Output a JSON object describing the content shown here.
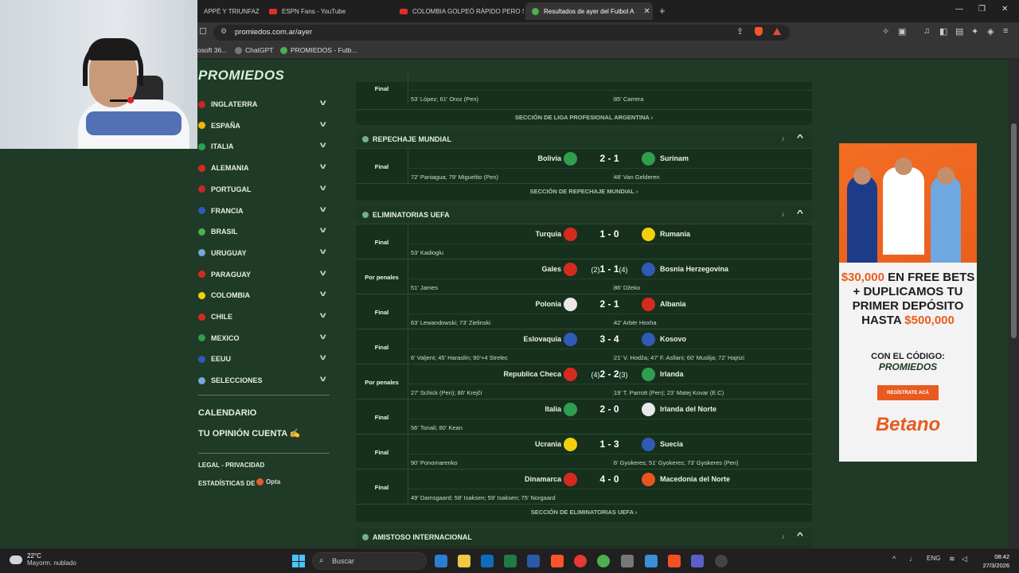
{
  "browser": {
    "tabs": [
      {
        "label": "APPÉ Y TRIUNFAZO :",
        "icon": "yt"
      },
      {
        "label": "ESPN Fans - YouTube",
        "icon": "yt"
      },
      {
        "label": "COLOMBIA GOLPEÓ RÁPIDO PERO S",
        "icon": "yt"
      },
      {
        "label": "Resultados de ayer del Futbol A",
        "icon": "fav",
        "active": true
      }
    ],
    "url": "promiedos.com.ar/ayer",
    "bookmarks": [
      "osoft 36...",
      "ChatGPT",
      "PROMIEDOS - Futb..."
    ]
  },
  "sidebar": {
    "logo": "PROMIEDOS",
    "items": [
      {
        "label": "INGLATERRA",
        "color": "#c62828"
      },
      {
        "label": "ESPAÑA",
        "color": "#f2b705"
      },
      {
        "label": "ITALIA",
        "color": "#2e9e4f"
      },
      {
        "label": "ALEMANIA",
        "color": "#d52b1e"
      },
      {
        "label": "PORTUGAL",
        "color": "#c62828"
      },
      {
        "label": "FRANCIA",
        "color": "#2f5bb7"
      },
      {
        "label": "BRASIL",
        "color": "#4caf50"
      },
      {
        "label": "URUGUAY",
        "color": "#7aa6d8"
      },
      {
        "label": "PARAGUAY",
        "color": "#d52b1e"
      },
      {
        "label": "COLOMBIA",
        "color": "#f2d10a"
      },
      {
        "label": "CHILE",
        "color": "#d52b1e"
      },
      {
        "label": "MEXICO",
        "color": "#2e9e4f"
      },
      {
        "label": "EEUU",
        "color": "#2f5bb7"
      },
      {
        "label": "SELECCIONES",
        "color": "#7aa6d8"
      }
    ],
    "calendario": "CALENDARIO",
    "opinion": "TU OPINIÓN CUENTA ✍",
    "legal": "LEGAL",
    "privacidad": "PRIVACIDAD",
    "estadisticas": "ESTADÍSTICAS DE",
    "opta": "Opta"
  },
  "top_partial": {
    "home_goals": "53' López; 61' Oroz (Pen)",
    "away_goals": "85' Carrera",
    "status": "Final",
    "footer": "SECCIÓN DE LIGA PROFESIONAL ARGENTINA ›"
  },
  "repechaje": {
    "title": "REPECHAJE MUNDIAL",
    "matches": [
      {
        "status": "Final",
        "home": "Bolivia",
        "away": "Surinam",
        "score": "2 - 1",
        "home_goals": "72' Paniagua; 79' Miguelito (Pen)",
        "away_goals": "48' Van Gelderen",
        "hc": "#2e9e4f",
        "ac": "#2e9e4f"
      }
    ],
    "footer": "SECCIÓN DE REPECHAJE MUNDIAL ›"
  },
  "uefa": {
    "title": "ELIMINATORIAS UEFA",
    "matches": [
      {
        "status": "Final",
        "home": "Turquia",
        "away": "Rumania",
        "score": "1 - 0",
        "home_goals": "53' Kadioglu",
        "away_goals": "",
        "hc": "#d52b1e",
        "ac": "#f2d10a"
      },
      {
        "status": "Por penales",
        "home": "Gales",
        "away": "Bosnia Herzegovina",
        "score": "1 - 1",
        "hpen": "(2)",
        "apen": "(4)",
        "home_goals": "51' James",
        "away_goals": "86' Džeko",
        "hc": "#d52b1e",
        "ac": "#2f5bb7"
      },
      {
        "status": "Final",
        "home": "Polonia",
        "away": "Albania",
        "score": "2 - 1",
        "home_goals": "63' Lewandowski; 73' Zielinski",
        "away_goals": "42' Arbër Hoxha",
        "hc": "#e8e8e8",
        "ac": "#d52b1e"
      },
      {
        "status": "Final",
        "home": "Eslovaquia",
        "away": "Kosovo",
        "score": "3 - 4",
        "home_goals": "6' Valjent; 45' Haraslín; 90'+4 Strelec",
        "away_goals": "21' V. Hodža; 47' F. Asllani; 60' Muslija; 72' Hajrizi",
        "hc": "#2f5bb7",
        "ac": "#2f5bb7"
      },
      {
        "status": "Por penales",
        "home": "Republica Checa",
        "away": "Irlanda",
        "score": "2 - 2",
        "hpen": "(4)",
        "apen": "(3)",
        "home_goals": "27' Schick (Pen); 86' Krejčí",
        "away_goals": "19' T. Parrott (Pen); 23' Matej Kovar (E.C)",
        "hc": "#d52b1e",
        "ac": "#2e9e4f"
      },
      {
        "status": "Final",
        "home": "Italia",
        "away": "Irlanda del Norte",
        "score": "2 - 0",
        "home_goals": "56' Tonali; 80' Kean",
        "away_goals": "",
        "hc": "#2e9e4f",
        "ac": "#e8e8e8"
      },
      {
        "status": "Final",
        "home": "Ucrania",
        "away": "Suecia",
        "score": "1 - 3",
        "home_goals": "90' Ponomarenko",
        "away_goals": "6' Gyokeres; 51' Gyokeres; 73' Gyokeres (Pen)",
        "hc": "#f2d10a",
        "ac": "#2f5bb7"
      },
      {
        "status": "Final",
        "home": "Dinamarca",
        "away": "Macedonia del Norte",
        "score": "4 - 0",
        "home_goals": "49' Damsgaard; 58' Isaksen; 59' Isaksen; 75' Norgaard",
        "away_goals": "",
        "hc": "#d52b1e",
        "ac": "#e8561e"
      }
    ],
    "footer": "SECCIÓN DE ELIMINATORIAS UEFA ›"
  },
  "amistoso": {
    "title": "AMISTOSO INTERNACIONAL"
  },
  "ad": {
    "amount1": "$30,000",
    "line1": "EN FREE BETS",
    "line2": "+ DUPLICAMOS TU",
    "line3": "PRIMER DEPÓSITO",
    "line4": "HASTA",
    "amount2": "$500,000",
    "code_label": "CON EL CÓDIGO:",
    "code": "PROMIEDOS",
    "button": "REGÍSTRATE ACÁ",
    "brand": "Betano"
  },
  "taskbar": {
    "temp": "22°C",
    "weather": "Mayorm. nublado",
    "search": "Buscar",
    "lang": "ENG",
    "time": "08:42",
    "date": "27/3/2026"
  }
}
